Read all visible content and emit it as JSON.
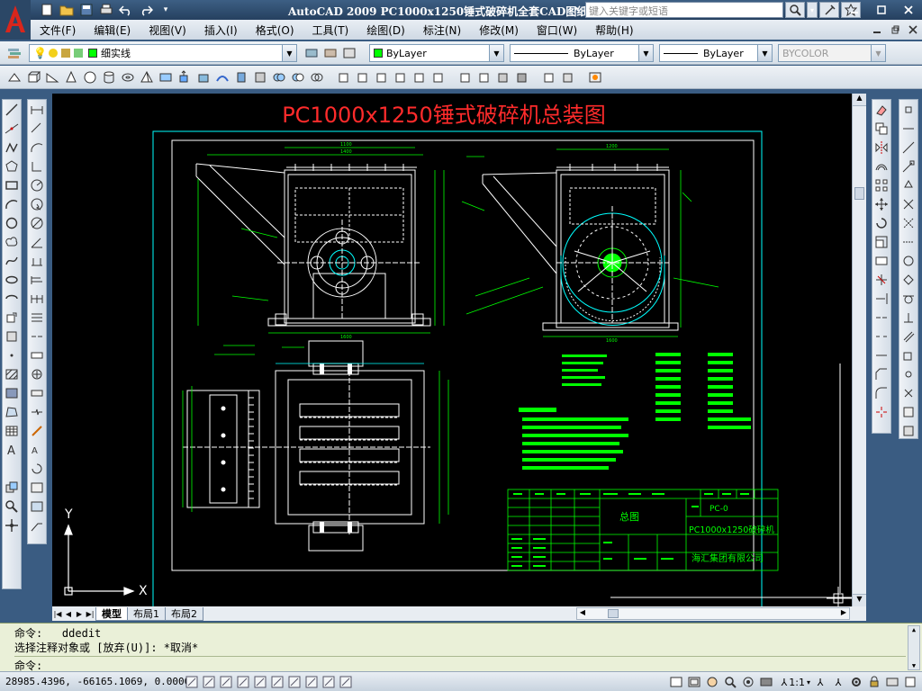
{
  "app": {
    "title_prefix": "AutoCAD 2009",
    "title_doc": "PC1000x1250锤式破碎机全套CAD图纸",
    "search_placeholder": "键入关键字或短语"
  },
  "menu": [
    "文件(F)",
    "编辑(E)",
    "视图(V)",
    "插入(I)",
    "格式(O)",
    "工具(T)",
    "绘图(D)",
    "标注(N)",
    "修改(M)",
    "窗口(W)",
    "帮助(H)"
  ],
  "layers": {
    "current_layer": "细实线",
    "color": "ByLayer",
    "linetype": "ByLayer",
    "lineweight": "ByLayer",
    "plotstyle": "BYCOLOR"
  },
  "drawing": {
    "title": "PC1000x1250锤式破碎机总装图",
    "title_color": "#ff2b2b",
    "title_block": {
      "drawing_name": "总图",
      "code": "PC-0",
      "product": "PC1000x1250破碎机",
      "company": "海汇集团有限公司"
    },
    "ucs": {
      "x": "X",
      "y": "Y"
    }
  },
  "tabs": [
    "模型",
    "布局1",
    "布局2"
  ],
  "active_tab": "模型",
  "command": {
    "line1_label": "命令:",
    "line1_value": "ddedit",
    "line2": "选择注释对象或 [放弃(U)]: *取消*",
    "prompt": "命令:"
  },
  "status": {
    "coords": "28985.4396, -66165.1069, 0.0000",
    "scale": "1:1"
  },
  "colors": {
    "cad_green": "#00ff00",
    "cad_cyan": "#00ffff",
    "cad_white": "#ffffff",
    "cad_red": "#ff2b2b"
  }
}
